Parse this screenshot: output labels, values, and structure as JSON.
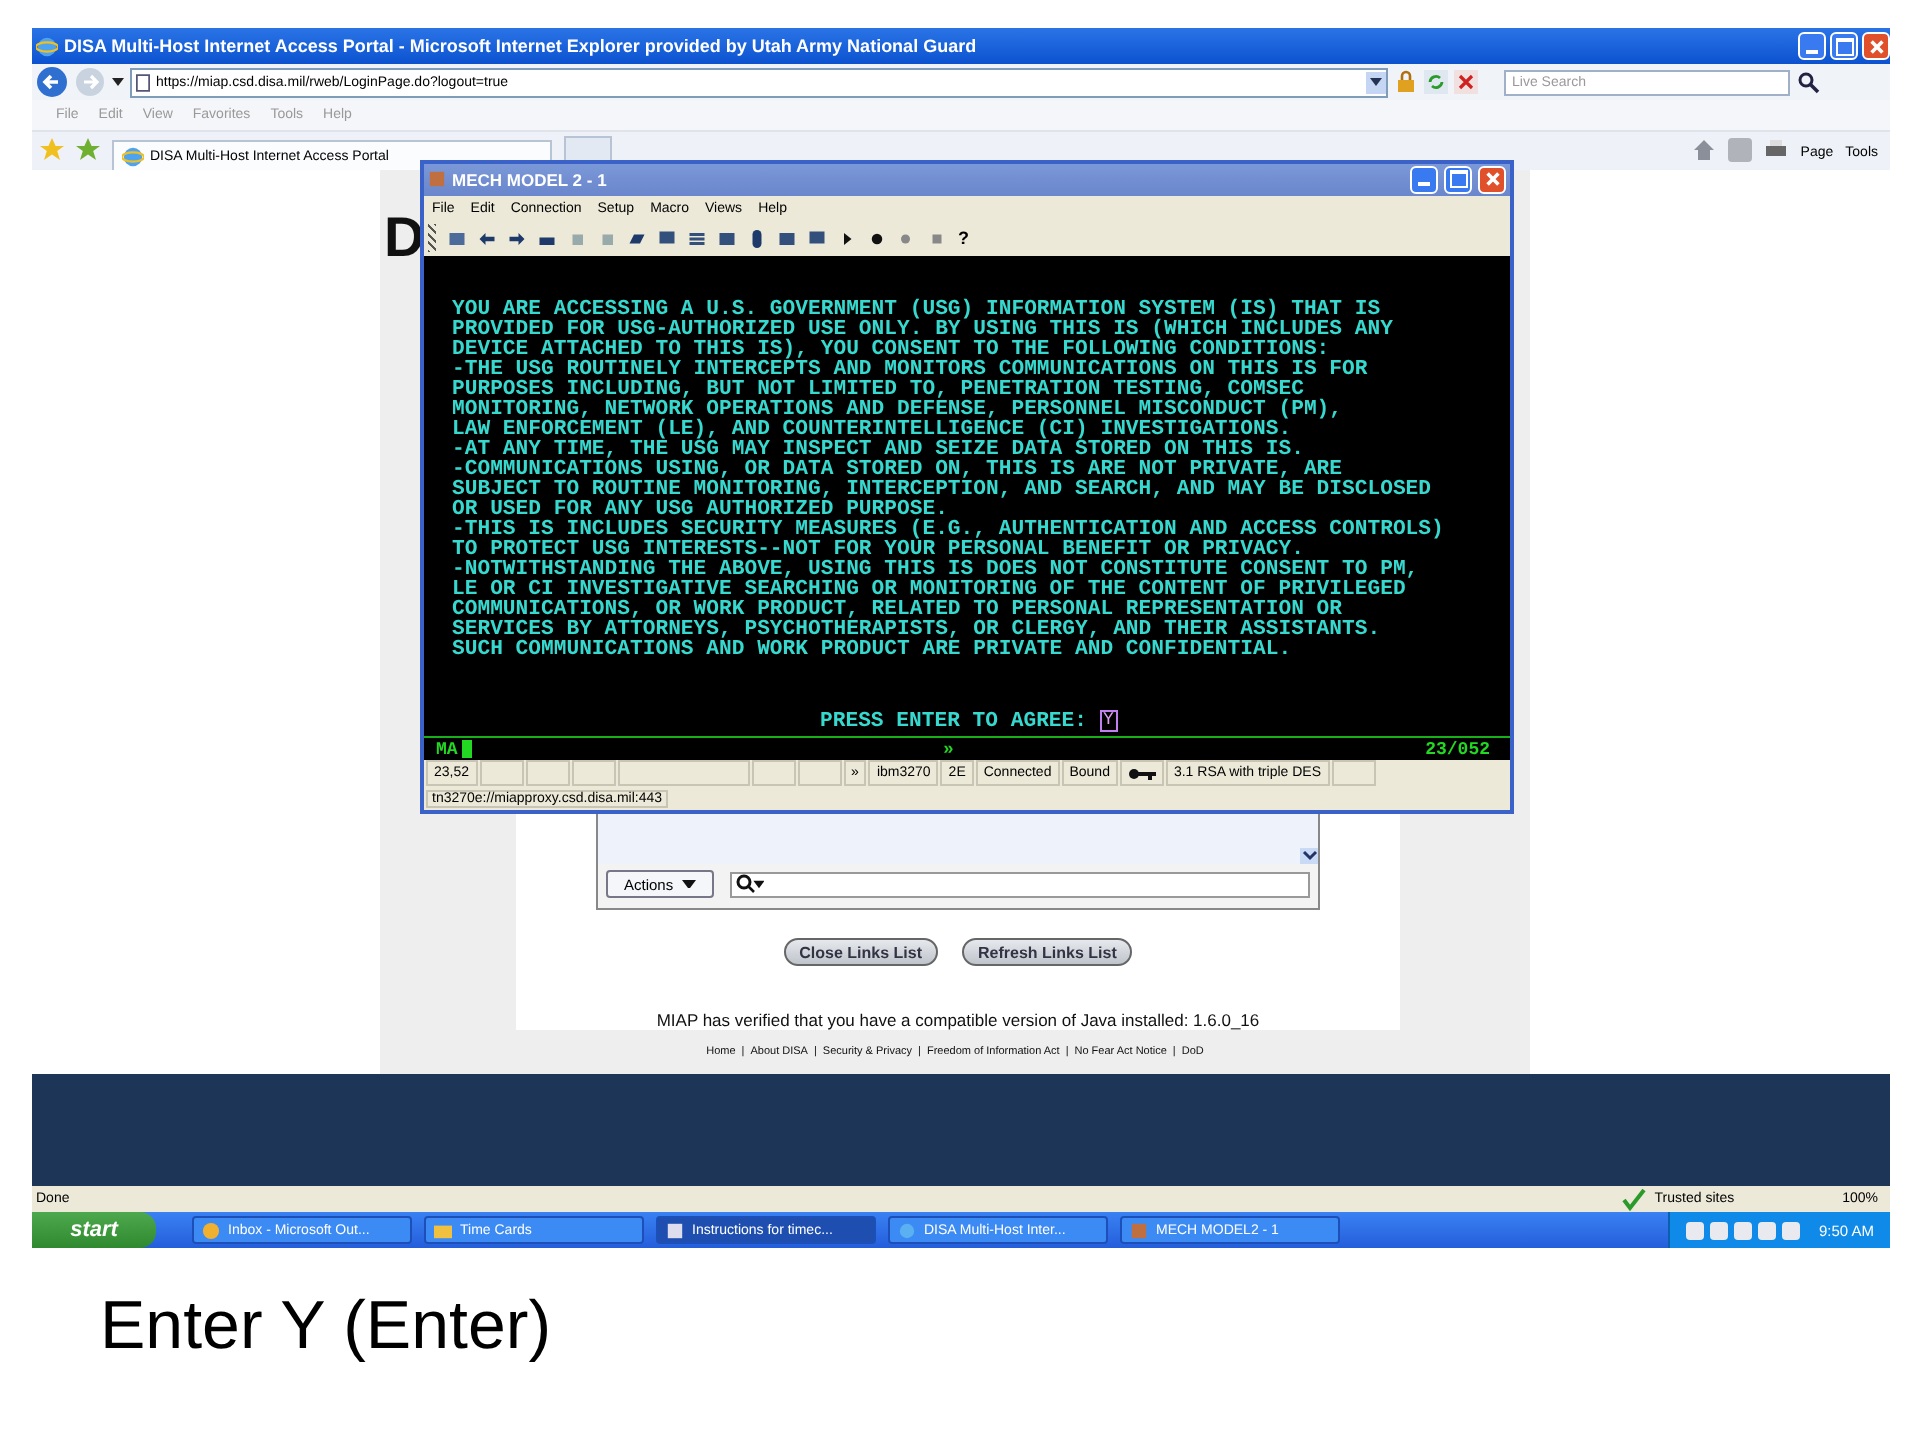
{
  "browser": {
    "title": "DISA Multi-Host Internet Access Portal - Microsoft Internet Explorer provided by Utah Army National Guard",
    "address": "https://miap.csd.disa.mil/rweb/LoginPage.do?logout=true",
    "search_placeholder": "Live Search",
    "menu": [
      "File",
      "Edit",
      "View",
      "Favorites",
      "Tools",
      "Help"
    ],
    "tab": "DISA Multi-Host Internet Access Portal",
    "tools": [
      "Page",
      "Tools"
    ]
  },
  "page": {
    "logo": "D",
    "actions": "Actions",
    "buttons": [
      "Close Links List",
      "Refresh Links List"
    ],
    "java_message": "MIAP has verified that you have a compatible version of Java installed: 1.6.0_16",
    "footer_separator": "|",
    "footer_links": [
      "Home",
      "About DISA",
      "Security & Privacy",
      "Freedom of Information Act",
      "No Fear Act Notice",
      "DoD"
    ]
  },
  "terminal": {
    "title": "MECH MODEL 2 - 1",
    "menu": [
      "File",
      "Edit",
      "Connection",
      "Setup",
      "Macro",
      "Views",
      "Help"
    ],
    "toolbar": [
      {
        "kind": "window"
      },
      {
        "kind": "left"
      },
      {
        "kind": "right"
      },
      {
        "kind": "printer"
      },
      {
        "kind": "copy"
      },
      {
        "kind": "copy"
      },
      {
        "kind": "folder"
      },
      {
        "kind": "monitor"
      },
      {
        "kind": "lines"
      },
      {
        "kind": "grid"
      },
      {
        "kind": "mouse"
      },
      {
        "kind": "grid"
      },
      {
        "kind": "monitor"
      },
      {
        "kind": "play"
      },
      {
        "kind": "dot"
      },
      {
        "kind": "dots"
      },
      {
        "kind": "square"
      },
      {
        "kind": "glyph",
        "text": "?"
      }
    ],
    "lines": [
      "YOU ARE ACCESSING A U.S. GOVERNMENT (USG) INFORMATION SYSTEM (IS) THAT IS",
      "PROVIDED FOR USG-AUTHORIZED USE ONLY. BY USING THIS IS (WHICH INCLUDES ANY",
      "DEVICE ATTACHED TO THIS IS), YOU CONSENT TO THE FOLLOWING CONDITIONS:",
      "-THE USG ROUTINELY INTERCEPTS AND MONITORS COMMUNICATIONS ON THIS IS FOR",
      "PURPOSES INCLUDING, BUT NOT LIMITED TO, PENETRATION TESTING, COMSEC",
      "MONITORING, NETWORK OPERATIONS AND DEFENSE, PERSONNEL MISCONDUCT (PM),",
      "LAW ENFORCEMENT (LE), AND COUNTERINTELLIGENCE (CI) INVESTIGATIONS.",
      "-AT ANY TIME, THE USG MAY INSPECT AND SEIZE DATA STORED ON THIS IS.",
      "-COMMUNICATIONS USING, OR DATA STORED ON, THIS IS ARE NOT PRIVATE, ARE",
      "SUBJECT TO ROUTINE MONITORING, INTERCEPTION, AND SEARCH, AND MAY BE DISCLOSED",
      "OR USED FOR ANY USG AUTHORIZED PURPOSE.",
      "-THIS IS INCLUDES SECURITY MEASURES (E.G., AUTHENTICATION AND ACCESS CONTROLS)",
      "TO PROTECT USG INTERESTS--NOT FOR YOUR PERSONAL BENEFIT OR PRIVACY.",
      "-NOTWITHSTANDING THE ABOVE, USING THIS IS DOES NOT CONSTITUTE CONSENT TO PM,",
      "LE OR CI INVESTIGATIVE SEARCHING OR MONITORING OF THE CONTENT OF PRIVILEGED",
      "COMMUNICATIONS, OR WORK PRODUCT, RELATED TO PERSONAL REPRESENTATION OR",
      "SERVICES BY ATTORNEYS, PSYCHOTHERAPISTS, OR CLERGY, AND THEIR ASSISTANTS.",
      "SUCH COMMUNICATIONS AND WORK PRODUCT ARE PRIVATE AND CONFIDENTIAL."
    ],
    "prompt": "PRESS ENTER TO AGREE:",
    "input": "Y",
    "oia": {
      "left": "MA",
      "middle": "»",
      "right": "23/052"
    },
    "cells": [
      {
        "kind": "text",
        "text": "23,52"
      },
      {
        "kind": "blank"
      },
      {
        "kind": "blank"
      },
      {
        "kind": "blank"
      },
      {
        "kind": "wide"
      },
      {
        "kind": "blank"
      },
      {
        "kind": "blank"
      },
      {
        "kind": "text",
        "text": "»"
      },
      {
        "kind": "text",
        "text": "ibm3270"
      },
      {
        "kind": "text",
        "text": "2E"
      },
      {
        "kind": "text",
        "text": "Connected"
      },
      {
        "kind": "text",
        "text": "Bound"
      },
      {
        "kind": "key"
      },
      {
        "kind": "text",
        "text": "3.1 RSA with triple DES"
      },
      {
        "kind": "blank"
      }
    ],
    "url": "tn3270e://miapproxy.csd.disa.mil:443"
  },
  "status_bar": {
    "text": "Done",
    "zone": "Trusted sites",
    "zoom": "100%"
  },
  "taskbar": {
    "start": "start",
    "items": [
      {
        "label": "Inbox - Microsoft Out...",
        "kind": "mail",
        "selected": false
      },
      {
        "label": "Time Cards",
        "kind": "folder",
        "selected": false
      },
      {
        "label": "Instructions for timec...",
        "kind": "doc",
        "selected": true
      },
      {
        "label": "DISA Multi-Host Inter...",
        "kind": "ie",
        "selected": false
      },
      {
        "label": "MECH MODEL2 - 1",
        "kind": "app",
        "selected": false
      }
    ],
    "clock": "9:50 AM"
  },
  "caption": "Enter Y (Enter)"
}
